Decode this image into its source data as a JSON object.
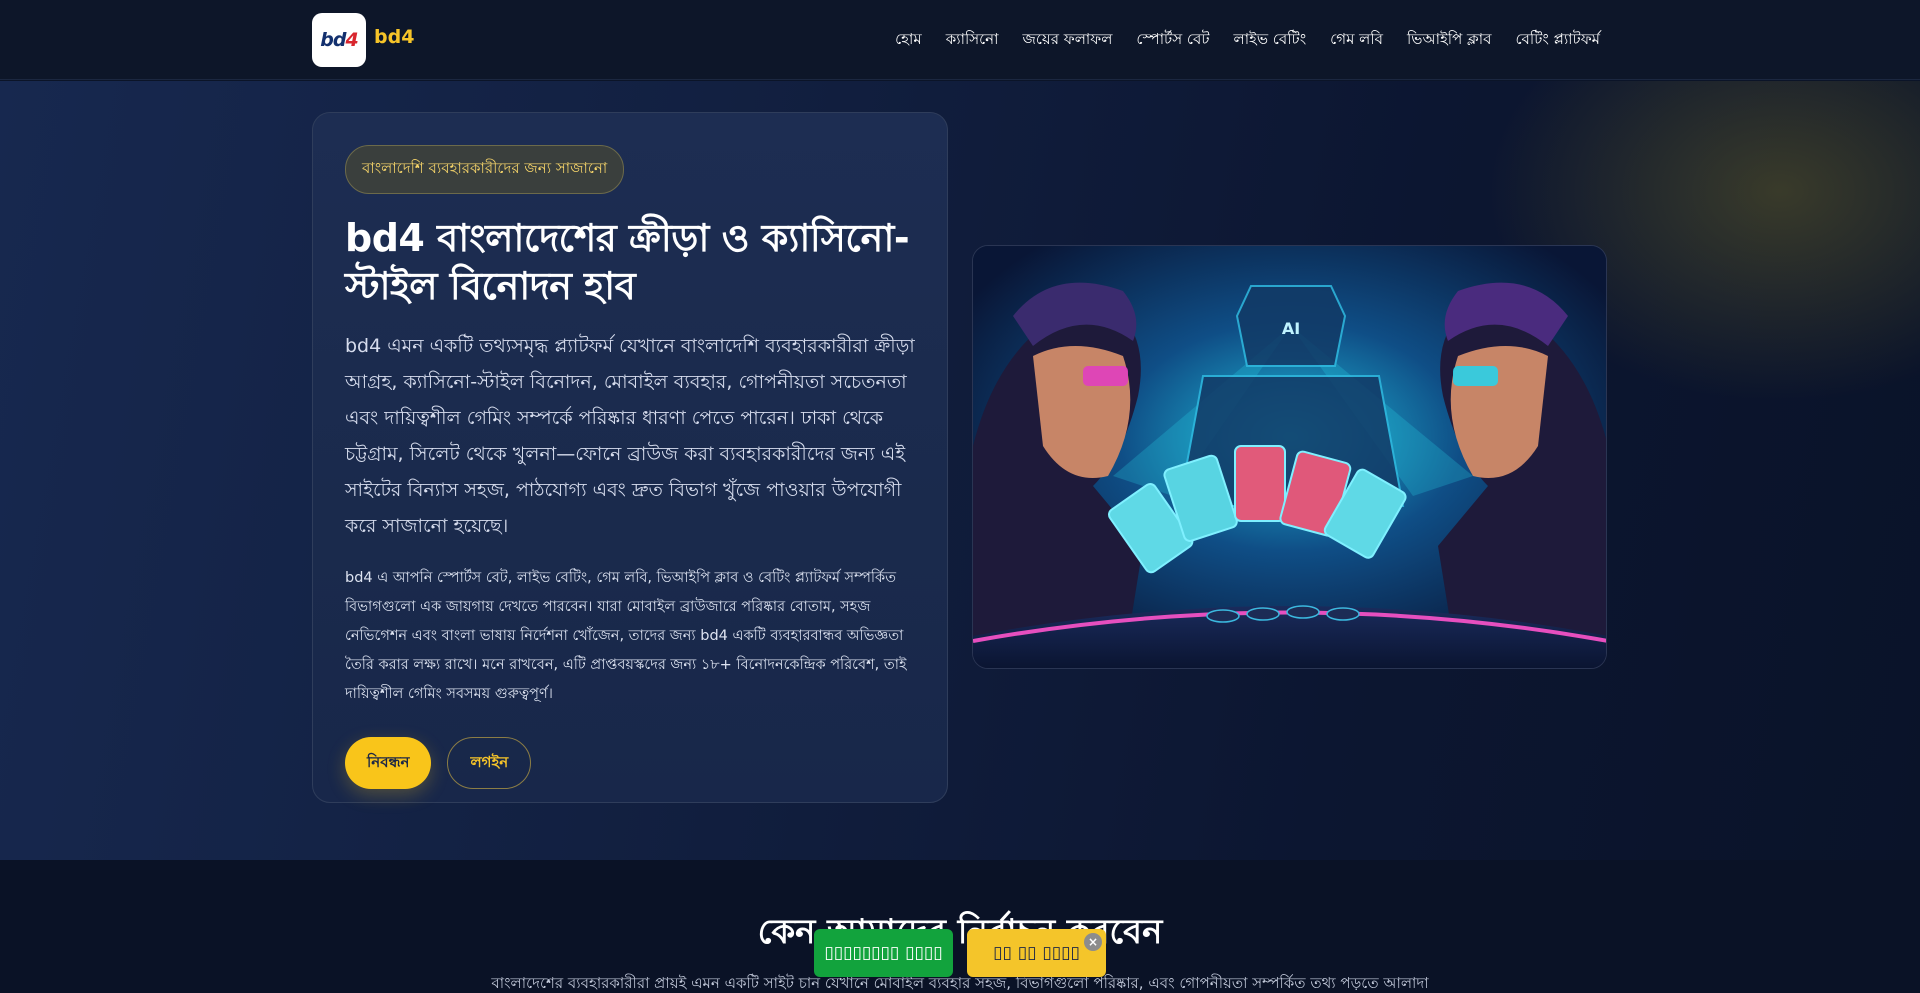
{
  "header": {
    "logo_text_dark": "bd",
    "logo_text_red": "4",
    "brand": "bd4",
    "nav": [
      {
        "label": "হোম"
      },
      {
        "label": "ক্যাসিনো"
      },
      {
        "label": "জয়ের ফলাফল"
      },
      {
        "label": "স্পোর্টস বেট"
      },
      {
        "label": "লাইভ বেটিং"
      },
      {
        "label": "গেম লবি"
      },
      {
        "label": "ভিআইপি ক্লাব"
      },
      {
        "label": "বেটিং প্ল্যাটফর্ম"
      }
    ]
  },
  "hero": {
    "badge": "বাংলাদেশি ব্যবহারকারীদের জন্য সাজানো",
    "title": "bd4 বাংলাদেশের ক্রীড়া ও ক্যাসিনো-স্টাইল বিনোদন হাব",
    "lead": "bd4 এমন একটি তথ্যসমৃদ্ধ প্ল্যাটফর্ম যেখানে বাংলাদেশি ব্যবহারকারীরা ক্রীড়া আগ্রহ, ক্যাসিনো-স্টাইল বিনোদন, মোবাইল ব্যবহার, গোপনীয়তা সচেতনতা এবং দায়িত্বশীল গেমিং সম্পর্কে পরিষ্কার ধারণা পেতে পারেন। ঢাকা থেকে চট্টগ্রাম, সিলেট থেকে খুলনা—ফোনে ব্রাউজ করা ব্যবহারকারীদের জন্য এই সাইটের বিন্যাস সহজ, পাঠযোগ্য এবং দ্রুত বিভাগ খুঁজে পাওয়ার উপযোগী করে সাজানো হয়েছে।",
    "body": "bd4 এ আপনি স্পোর্টস বেট, লাইভ বেটিং, গেম লবি, ভিআইপি ক্লাব ও বেটিং প্ল্যাটফর্ম সম্পর্কিত বিভাগগুলো এক জায়গায় দেখতে পারবেন। যারা মোবাইল ব্রাউজারে পরিষ্কার বোতাম, সহজ নেভিগেশন এবং বাংলা ভাষায় নির্দেশনা খোঁজেন, তাদের জন্য bd4 একটি ব্যবহারবান্ধব অভিজ্ঞতা তৈরি করার লক্ষ্য রাখে। মনে রাখবেন, এটি প্রাপ্তবয়স্কদের জন্য ১৮+ বিনোদনকেন্দ্রিক পরিবেশ, তাই দায়িত্বশীল গেমিং সবসময় গুরুত্বপূর্ণ।",
    "register_label": "নিবন্ধন",
    "login_label": "লগইন",
    "image_label": "AI"
  },
  "section": {
    "title": "কেন আমাদের নির্বাচন করবেন",
    "text": "বাংলাদেশের ব্যবহারকারীরা প্রায়ই এমন একটি সাইট চান যেখানে মোবাইল ব্যবহার সহজ, বিভাগগুলো পরিষ্কার, এবং গোপনীয়তা সম্পর্কিত তথ্য পড়তে আলাদা"
  },
  "floating": {
    "green_label": "▯▯▯▯▯▯▯▯ ▯▯▯▯",
    "yellow_label": "▯▯ ▯▯ ▯▯▯▯",
    "close": "×"
  },
  "colors": {
    "accent": "#f9c51a",
    "background": "#0b1428",
    "card": "#1d2d52",
    "green": "#12a33d"
  }
}
